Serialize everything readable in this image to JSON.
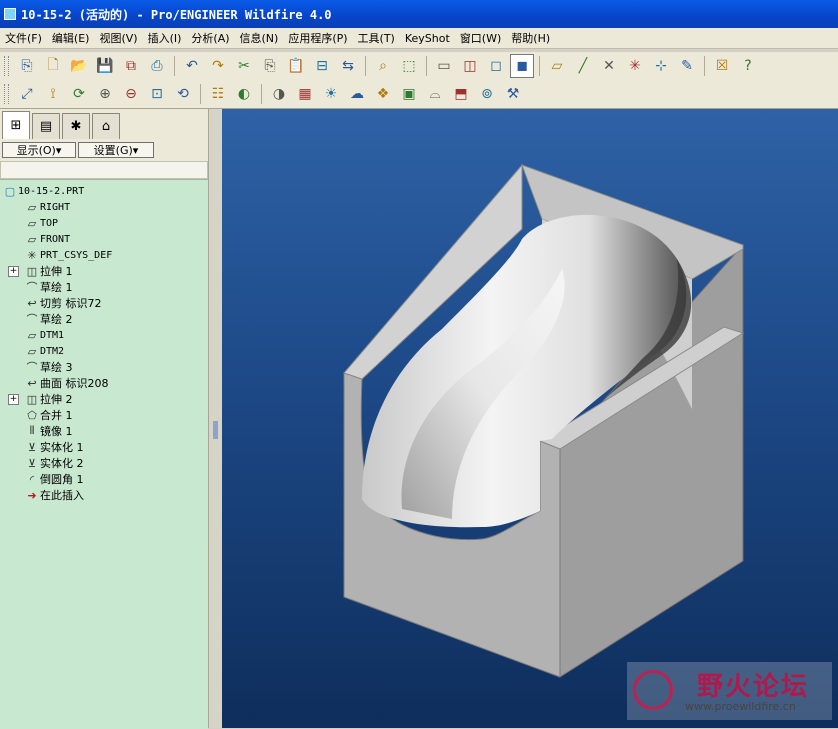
{
  "window": {
    "title": "10-15-2 (活动的) - Pro/ENGINEER Wildfire 4.0"
  },
  "menu": [
    "文件(F)",
    "编辑(E)",
    "视图(V)",
    "插入(I)",
    "分析(A)",
    "信息(N)",
    "应用程序(P)",
    "工具(T)",
    "KeyShot",
    "窗口(W)",
    "帮助(H)"
  ],
  "toolbar1_icons": [
    "new-session-icon",
    "new-file-icon",
    "open-icon",
    "save-icon",
    "save-copy-icon",
    "print-icon",
    "undo-icon",
    "redo-icon",
    "cut-icon",
    "copy-icon",
    "paste-icon",
    "paste-special-icon",
    "regenerate-icon",
    "find-icon",
    "select-box-icon",
    "hidden-line-icon",
    "wireframe-icon",
    "no-hidden-icon",
    "shaded-icon",
    "datum-plane-icon",
    "datum-axis-icon",
    "datum-point-icon",
    "csys-icon",
    "spin-center-icon",
    "sketch-tool-icon",
    "close-window-icon",
    "context-help-icon"
  ],
  "toolbar2_icons": [
    "refit-icon",
    "orient-icon",
    "saved-views-icon",
    "zoom-in-icon",
    "zoom-out-icon",
    "zoom-fit-icon",
    "repaint-icon",
    "layers-icon",
    "model-display-icon",
    "appearance-icon",
    "scene-icon",
    "light-icon",
    "environment-icon",
    "render-icon",
    "photo-icon",
    "teapot-icon",
    "box-render-icon",
    "camera-icon",
    "tools-icon"
  ],
  "navigator": {
    "tabs": [
      "model-tree-tab",
      "folder-tab",
      "favorites-tab",
      "connections-tab"
    ],
    "show_button": "显示(O)",
    "settings_button": "设置(G)"
  },
  "tree": {
    "root": "10-15-2.PRT",
    "items": [
      {
        "label": "RIGHT",
        "icon": "datum-plane-icon",
        "expandable": false
      },
      {
        "label": "TOP",
        "icon": "datum-plane-icon",
        "expandable": false
      },
      {
        "label": "FRONT",
        "icon": "datum-plane-icon",
        "expandable": false
      },
      {
        "label": "PRT_CSYS_DEF",
        "icon": "csys-icon",
        "expandable": false
      },
      {
        "label": "拉伸 1",
        "icon": "extrude-icon",
        "expandable": true
      },
      {
        "label": "草绘 1",
        "icon": "sketch-icon",
        "expandable": false
      },
      {
        "label": "切剪 标识72",
        "icon": "cut-feature-icon",
        "expandable": false
      },
      {
        "label": "草绘 2",
        "icon": "sketch-icon",
        "expandable": false
      },
      {
        "label": "DTM1",
        "icon": "datum-plane-icon",
        "expandable": false
      },
      {
        "label": "DTM2",
        "icon": "datum-plane-icon",
        "expandable": false
      },
      {
        "label": "草绘 3",
        "icon": "sketch-icon",
        "expandable": false
      },
      {
        "label": "曲面 标识208",
        "icon": "surface-icon",
        "expandable": false
      },
      {
        "label": "拉伸 2",
        "icon": "extrude-icon",
        "expandable": true
      },
      {
        "label": "合并 1",
        "icon": "merge-icon",
        "expandable": false
      },
      {
        "label": "镜像 1",
        "icon": "mirror-icon",
        "expandable": false
      },
      {
        "label": "实体化 1",
        "icon": "solidify-icon",
        "expandable": false
      },
      {
        "label": "实体化 2",
        "icon": "solidify-icon",
        "expandable": false
      },
      {
        "label": "倒圆角 1",
        "icon": "round-icon",
        "expandable": false
      },
      {
        "label": "在此插入",
        "icon": "insert-here-icon",
        "expandable": false
      }
    ]
  },
  "watermark": {
    "title": "野火论坛",
    "url": "www.proewildfire.cn"
  }
}
